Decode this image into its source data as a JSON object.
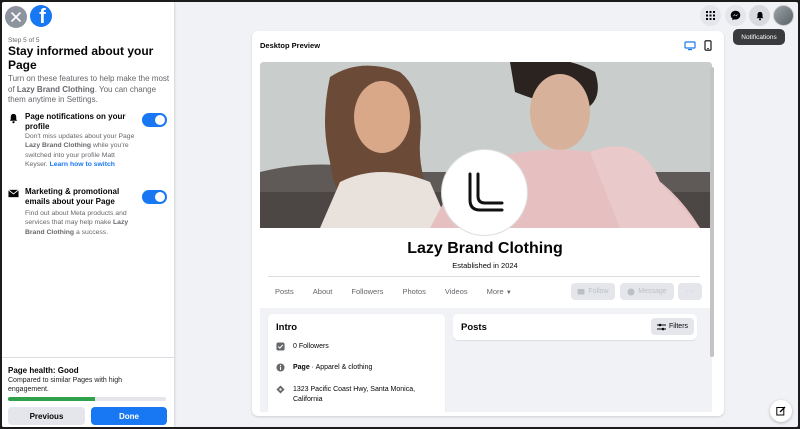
{
  "wizard": {
    "step": "Step 5 of 5",
    "title": "Stay informed about your Page",
    "description_pre": "Turn on these features to help make the most of ",
    "description_page": "Lazy Brand Clothing",
    "description_post": ". You can change them anytime in Settings.",
    "options": [
      {
        "title": "Page notifications on your profile",
        "desc_pre": "Don't miss updates about your Page ",
        "desc_page": "Lazy Brand Clothing",
        "desc_post": " while you're switched into your profile Matt Keyser. ",
        "link": "Learn how to switch",
        "enabled": true,
        "icon": "bell-icon"
      },
      {
        "title": "Marketing & promotional emails about your Page",
        "desc_pre": "Find out about Meta products and services that may help make ",
        "desc_page": "Lazy Brand Clothing",
        "desc_post": " a success.",
        "enabled": true,
        "icon": "envelope-icon"
      }
    ],
    "health": {
      "title": "Page health: Good",
      "description": "Compared to similar Pages with high engagement.",
      "progress": 0.55,
      "color": "#31a24c"
    },
    "buttons": {
      "previous": "Previous",
      "done": "Done"
    }
  },
  "topbar": {
    "icons": [
      "menu-grid-icon",
      "messenger-icon",
      "notifications-bell-icon",
      "account-avatar"
    ],
    "tooltip": "Notifications"
  },
  "preview": {
    "label": "Desktop Preview",
    "devices": [
      "desktop-icon",
      "mobile-icon"
    ],
    "page": {
      "name": "Lazy Brand Clothing",
      "established": "Established in 2024",
      "tabs": [
        "Posts",
        "About",
        "Followers",
        "Photos",
        "Videos",
        "More"
      ],
      "actions": {
        "follow": "Follow",
        "message": "Message",
        "more": "···"
      },
      "intro": {
        "title": "Intro",
        "followers": "0 Followers",
        "category_bold": "Page",
        "category_rest": " · Apparel & clothing",
        "address": "1323 Pacific Coast Hwy, Santa Monica, California"
      },
      "posts": {
        "title": "Posts",
        "filters": "Filters"
      }
    }
  },
  "colors": {
    "accent": "#1877f2",
    "bg": "#f0f2f5"
  }
}
